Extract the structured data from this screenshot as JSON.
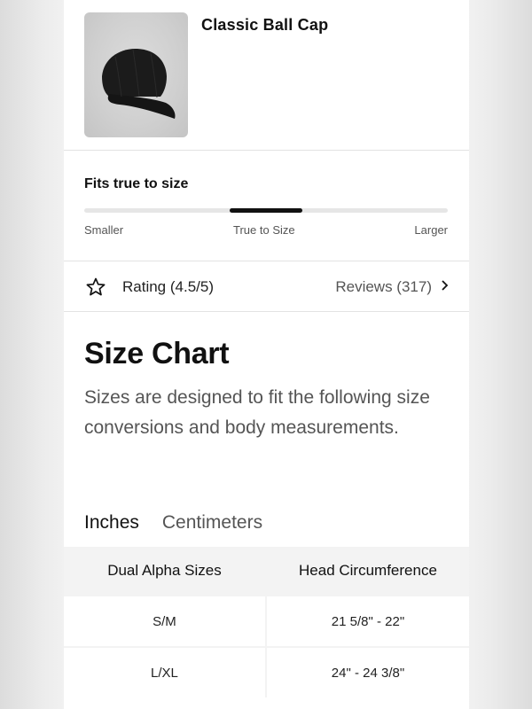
{
  "product": {
    "name": "Classic Ball Cap"
  },
  "fit": {
    "title": "Fits true to size",
    "position_fraction": 0.5,
    "labels": {
      "smaller": "Smaller",
      "true": "True to Size",
      "larger": "Larger"
    }
  },
  "rating": {
    "label": "Rating (4.5/5)",
    "reviews": "Reviews (317)"
  },
  "size_chart": {
    "title": "Size Chart",
    "description": "Sizes are designed to fit the following size conversions and body measurements.",
    "tabs": [
      {
        "label": "Inches",
        "active": true
      },
      {
        "label": "Centimeters",
        "active": false
      }
    ],
    "columns": [
      "Dual Alpha Sizes",
      "Head Circumference"
    ],
    "rows": [
      [
        "S/M",
        "21 5/8\" - 22\""
      ],
      [
        "L/XL",
        "24\" - 24 3/8\""
      ]
    ]
  },
  "colors": {
    "accent": "#a4123f",
    "text": "#111111",
    "muted": "#555555"
  }
}
